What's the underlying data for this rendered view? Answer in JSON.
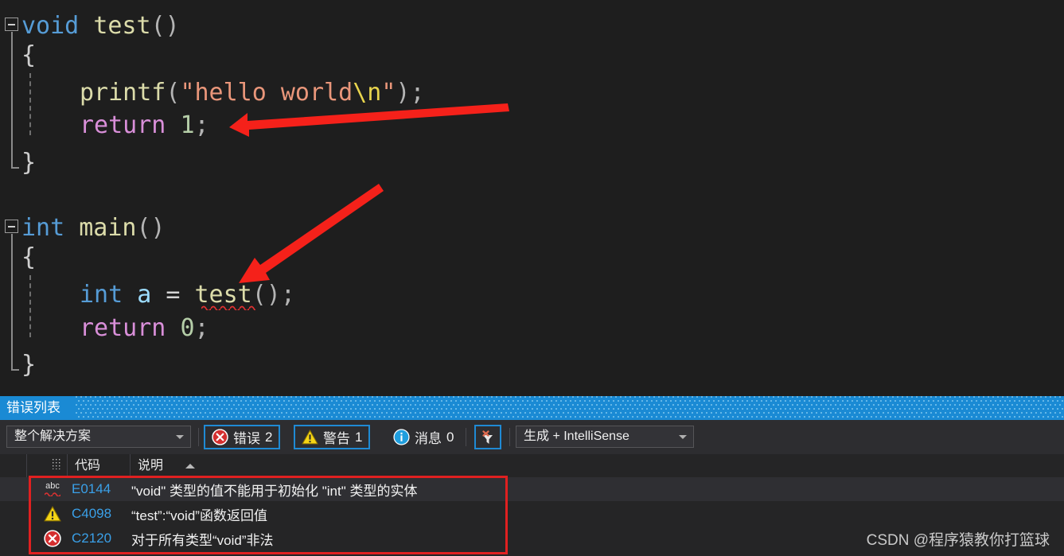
{
  "editor": {
    "language": "c",
    "background": "#1e1e1e",
    "lines": [
      {
        "id": "l1",
        "text": "void test()"
      },
      {
        "id": "l2",
        "text": "{"
      },
      {
        "id": "l3",
        "text": "printf(\"hello world\\n\");"
      },
      {
        "id": "l4",
        "text": "return 1;"
      },
      {
        "id": "l5",
        "text": "}"
      },
      {
        "id": "l6",
        "text": ""
      },
      {
        "id": "l7",
        "text": "int main()"
      },
      {
        "id": "l8",
        "text": "{"
      },
      {
        "id": "l9",
        "text": "int a = test();"
      },
      {
        "id": "l10",
        "text": "return 0;"
      },
      {
        "id": "l11",
        "text": "}"
      }
    ],
    "tokens": {
      "kw_void": "void",
      "fn_test": "test",
      "paren_empty": "()",
      "brace_open": "{",
      "brace_close": "}",
      "fn_printf": "printf",
      "paren_l": "(",
      "paren_r": ")",
      "string_hello": "\"hello world",
      "escape_n": "\\n",
      "quote_close": "\"",
      "semi": ";",
      "kw_return": "return",
      "num_one": "1",
      "num_zero": "0",
      "kw_int": "int",
      "fn_main": "main",
      "var_a": "a",
      "op_assign": "=",
      "call_test": "test"
    },
    "colors": {
      "keyword": "#569cd6",
      "function": "#dcdcaa",
      "string": "#e9967a",
      "escape": "#e8d44d",
      "control": "#d98fd9",
      "number": "#b5cea8",
      "variable": "#9cdcfe",
      "punctuation": "#b4b4b4",
      "error_squiggle": "#e03131"
    }
  },
  "annotations": {
    "color": "#f5211a",
    "arrows": [
      {
        "name": "arrow-to-return-1",
        "target": "return 1;"
      },
      {
        "name": "arrow-to-test-call",
        "target": "test()"
      }
    ],
    "highlight_box": {
      "name": "error-rows-highlight",
      "color": "#e02020"
    }
  },
  "panel": {
    "title": "错误列表",
    "toolbar": {
      "scope_combo": {
        "value": "整个解决方案",
        "caret": "chevron-down-icon"
      },
      "errors": {
        "label": "错误",
        "count": "2",
        "icon": "error-circle-icon",
        "active": true
      },
      "warnings": {
        "label": "警告",
        "count": "1",
        "icon": "warning-triangle-icon",
        "active": true
      },
      "messages": {
        "label": "消息",
        "count": "0",
        "icon": "info-circle-icon",
        "active": false
      },
      "clear_filter": {
        "icon": "clear-filter-icon",
        "tooltip": "清除筛选器"
      },
      "source_combo": {
        "value": "生成 + IntelliSense",
        "caret": "chevron-down-icon"
      }
    },
    "columns": [
      {
        "key": "code",
        "label": "代码",
        "sorted": false
      },
      {
        "key": "description",
        "label": "说明",
        "sorted": true,
        "sort_dir": "asc"
      }
    ],
    "rows": [
      {
        "icon": "intellisense-squiggle-icon",
        "icon_text": "abc",
        "code": "E0144",
        "description": "\"void\" 类型的值不能用于初始化 \"int\" 类型的实体",
        "severity": "intellisense-error",
        "selected": true
      },
      {
        "icon": "warning-triangle-icon",
        "code": "C4098",
        "description": "“test”:“void”函数返回值",
        "severity": "warning",
        "selected": false
      },
      {
        "icon": "error-circle-icon",
        "code": "C2120",
        "description": "对于所有类型“void”非法",
        "severity": "error",
        "selected": false
      }
    ]
  },
  "watermark": "CSDN @程序猿教你打篮球"
}
